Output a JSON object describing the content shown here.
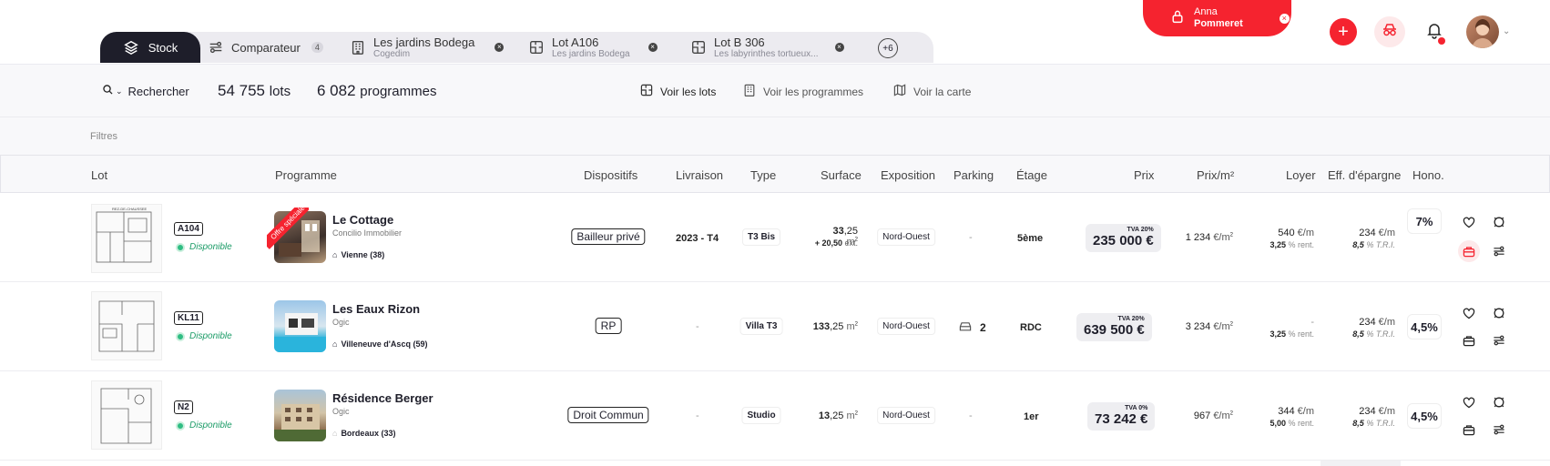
{
  "tabs": {
    "stock": "Stock",
    "comparateur": "Comparateur",
    "comparateur_count": "4",
    "t1_title": "Les jardins Bodega",
    "t1_sub": "Cogedim",
    "t2_title": "Lot A106",
    "t2_sub": "Les jardins Bodega",
    "t3_title": "Lot B 306",
    "t3_sub": "Les labyrinthes tortueux...",
    "more": "+6"
  },
  "user": {
    "first": "Anna",
    "last": "Pommeret"
  },
  "search": {
    "label": "Rechercher",
    "lots_count": "54 755",
    "lots_label": "lots",
    "prog_count": "6 082",
    "prog_label": "programmes",
    "voir_lots": "Voir les lots",
    "voir_programmes": "Voir les programmes",
    "voir_carte": "Voir la carte"
  },
  "filters_label": "Filtres",
  "headers": {
    "lot": "Lot",
    "programme": "Programme",
    "dispositifs": "Dispositifs",
    "livraison": "Livraison",
    "type": "Type",
    "surface": "Surface",
    "exposition": "Exposition",
    "parking": "Parking",
    "etage": "Étage",
    "prix": "Prix",
    "prixm2": "Prix/m²",
    "loyer": "Loyer",
    "epargne": "Eff. d'épargne",
    "hono": "Hono."
  },
  "ribbon": "Offre spéciale",
  "rows": [
    {
      "lot": "A104",
      "status": "Disponible",
      "prog": "Le Cottage",
      "dev": "Concilio Immobilier",
      "city": "Vienne (38)",
      "dispositif": "Bailleur privé",
      "livraison": "2023 - T4",
      "type": "T3 Bis",
      "surf_int": "33",
      "surf_dec": ",25",
      "surf_unit": "m",
      "surf_ext": "+ 20,50",
      "surf_ext_label": "ext.",
      "exposition": "Nord-Ouest",
      "parking": "-",
      "parking_n": "",
      "etage": "5ème",
      "tva": "TVA 20%",
      "prix": "235 000 €",
      "prixm2_v": "1 234",
      "prixm2_u": "€/m",
      "loyer_v": "540",
      "loyer_u": "€/m",
      "rent_v": "3,25",
      "rent_u": "% rent.",
      "epar_v": "234",
      "epar_u": "€/m",
      "tri_v": "8,5",
      "tri_u": "% T.R.I.",
      "hono": "7%"
    },
    {
      "lot": "KL11",
      "status": "Disponible",
      "prog": "Les Eaux Rizon",
      "dev": "Ogic",
      "city": "Villeneuve d'Ascq (59)",
      "dispositif": "RP",
      "livraison": "-",
      "type": "Villa T3",
      "surf_int": "133",
      "surf_dec": ",25",
      "surf_unit": "m",
      "surf_ext": "",
      "surf_ext_label": "",
      "exposition": "Nord-Ouest",
      "parking": "",
      "parking_n": "2",
      "etage": "RDC",
      "tva": "TVA 20%",
      "prix": "639 500 €",
      "prixm2_v": "3 234",
      "prixm2_u": "€/m",
      "loyer_v": "-",
      "loyer_u": "",
      "rent_v": "3,25",
      "rent_u": "% rent.",
      "epar_v": "234",
      "epar_u": "€/m",
      "tri_v": "8,5",
      "tri_u": "% T.R.I.",
      "hono": "4,5%"
    },
    {
      "lot": "N2",
      "status": "Disponible",
      "prog": "Résidence Berger",
      "dev": "Ogic",
      "city": "Bordeaux (33)",
      "dispositif": "Droit Commun",
      "livraison": "-",
      "type": "Studio",
      "surf_int": "13",
      "surf_dec": ",25",
      "surf_unit": "m",
      "surf_ext": "",
      "surf_ext_label": "",
      "exposition": "Nord-Ouest",
      "parking": "-",
      "parking_n": "",
      "etage": "1er",
      "tva": "TVA 0%",
      "prix": "73 242 €",
      "prixm2_v": "967",
      "prixm2_u": "€/m",
      "loyer_v": "344",
      "loyer_u": "€/m",
      "rent_v": "5,00",
      "rent_u": "% rent.",
      "epar_v": "234",
      "epar_u": "€/m",
      "tri_v": "8,5",
      "tri_u": "% T.R.I.",
      "hono": "4,5%"
    }
  ],
  "colors": {
    "accent": "#f5232f",
    "dark": "#1e1e2a",
    "success": "#2fbd83"
  }
}
